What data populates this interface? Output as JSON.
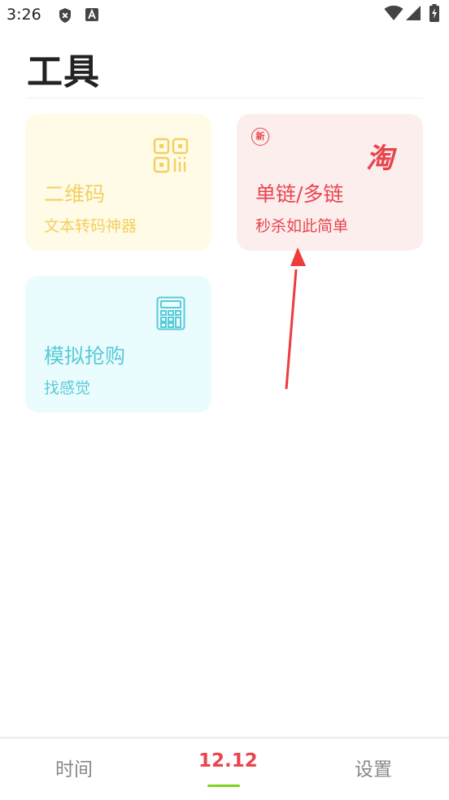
{
  "status_bar": {
    "time": "3:26",
    "icons": [
      "shield-x-icon",
      "a-badge-icon",
      "wifi-icon",
      "signal-icon",
      "battery-charging-icon"
    ]
  },
  "page": {
    "title": "工具"
  },
  "cards": [
    {
      "title": "二维码",
      "subtitle": "文本转码神器",
      "icon": "qr-code-icon",
      "color": "#f3d062",
      "background": "#fffbe6"
    },
    {
      "title": "单链/多链",
      "subtitle": "秒杀如此简单",
      "icon": "taobao-logo",
      "logo_text": "淘",
      "badge": "新",
      "color": "#e8454f",
      "background": "#fdeeee"
    },
    {
      "title": "模拟抢购",
      "subtitle": "找感觉",
      "icon": "calculator-icon",
      "color": "#58cad8",
      "background": "#ebfcfe"
    }
  ],
  "bottom_nav": {
    "tabs": [
      {
        "label": "时间",
        "active": false
      },
      {
        "label": "12.12",
        "active": true
      },
      {
        "label": "设置",
        "active": false
      }
    ],
    "active_color": "#e8454f",
    "indicator_color": "#7ed321"
  }
}
